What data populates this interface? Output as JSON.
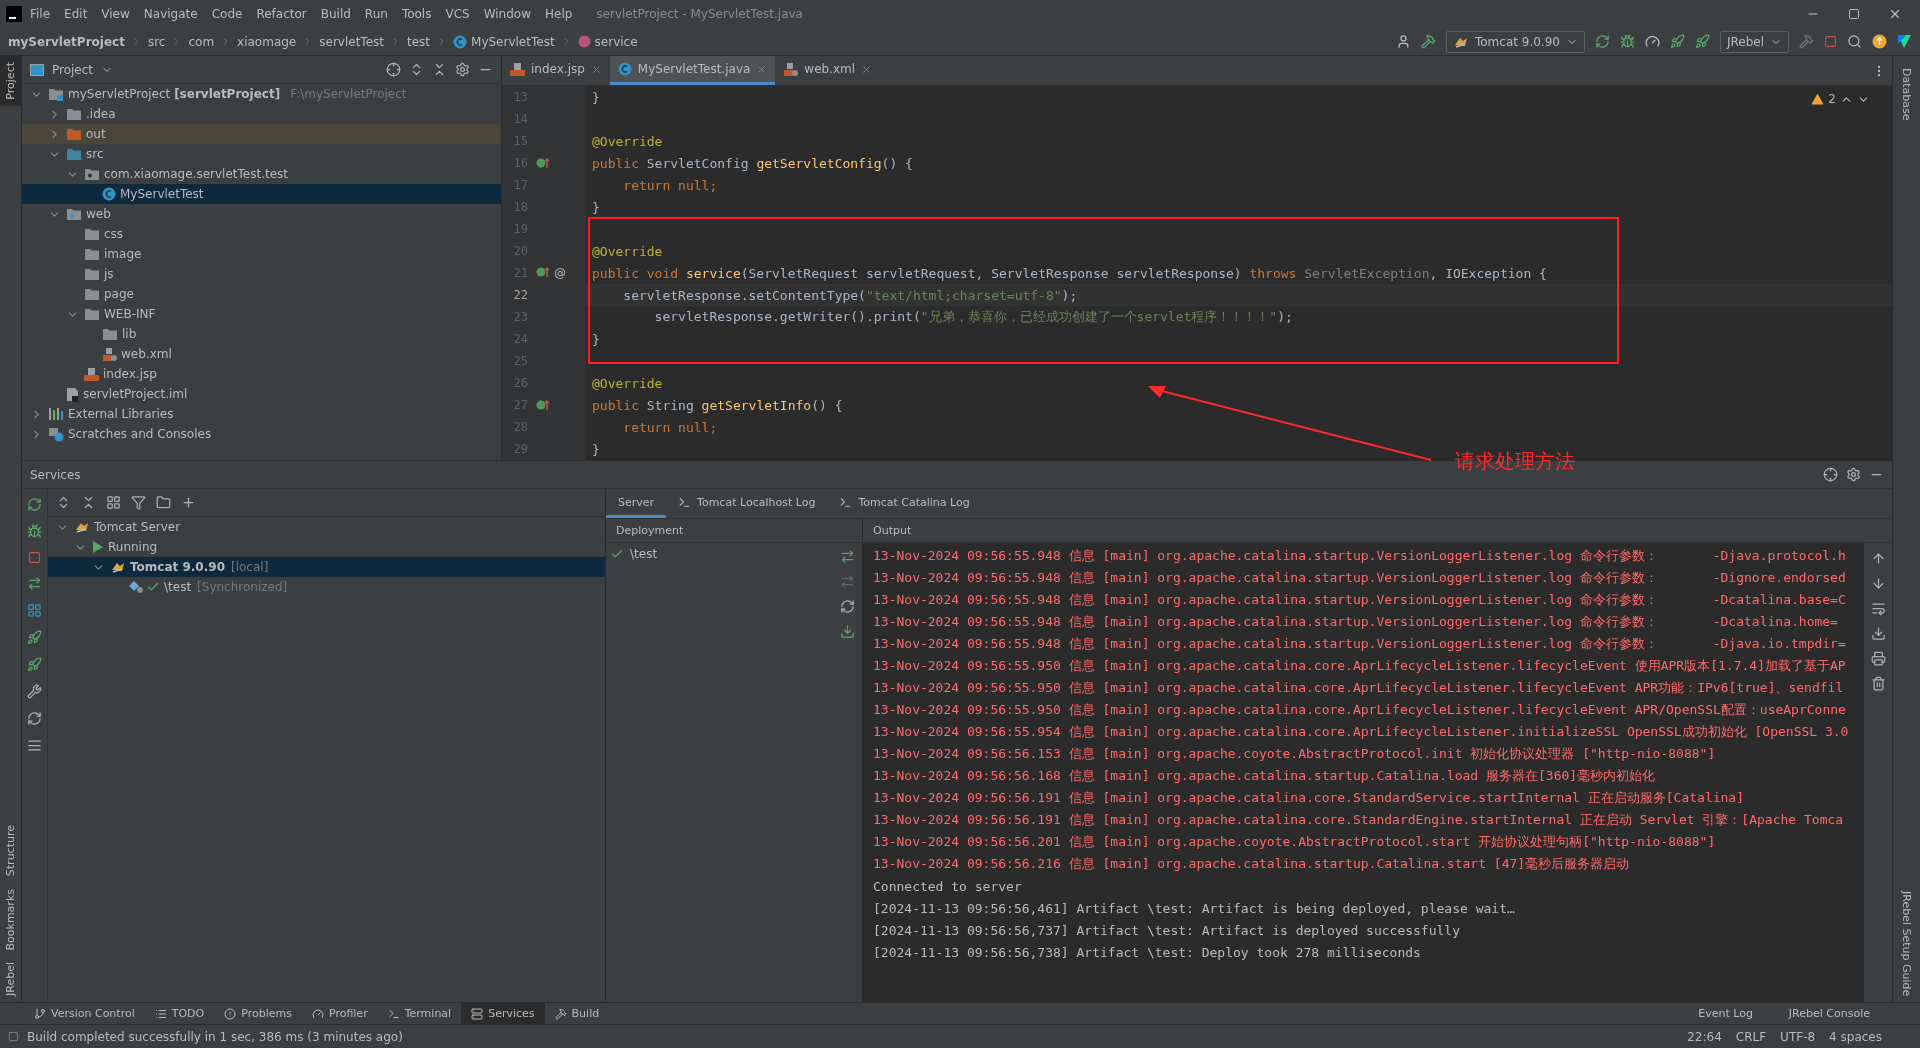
{
  "window": {
    "title": "servletProject - MyServletTest.java"
  },
  "menu": [
    "File",
    "Edit",
    "View",
    "Navigate",
    "Code",
    "Refactor",
    "Build",
    "Run",
    "Tools",
    "VCS",
    "Window",
    "Help"
  ],
  "breadcrumbs": [
    {
      "label": "myServletProject",
      "kind": "project"
    },
    {
      "label": "src",
      "kind": "plain"
    },
    {
      "label": "com",
      "kind": "plain"
    },
    {
      "label": "xiaomage",
      "kind": "plain"
    },
    {
      "label": "servletTest",
      "kind": "plain"
    },
    {
      "label": "test",
      "kind": "plain"
    },
    {
      "label": "MyServletTest",
      "kind": "class"
    },
    {
      "label": "service",
      "kind": "method"
    }
  ],
  "toolbar": {
    "run_config": "Tomcat 9.0.90",
    "jrebel": "JRebel"
  },
  "left_stripe": [
    {
      "label": "Project",
      "selected": true
    },
    {
      "label": "Structure",
      "selected": false
    },
    {
      "label": "Bookmarks",
      "selected": false
    },
    {
      "label": "JRebel",
      "selected": false
    }
  ],
  "right_stripe": [
    {
      "label": "Database"
    },
    {
      "label": "JRebel Setup Guide"
    }
  ],
  "project_panel": {
    "title": "Project",
    "tree": [
      {
        "label": "myServletProject **[servletProject]**",
        "path": "F:\\myServletProject",
        "kind": "module",
        "expanded": true,
        "selected": false,
        "children": [
          {
            "label": ".idea",
            "kind": "folder",
            "expanded": false,
            "selected": false
          },
          {
            "label": "out",
            "kind": "excluded",
            "expanded": false,
            "selected": false
          },
          {
            "label": "src",
            "kind": "source",
            "expanded": true,
            "selected": false,
            "children": [
              {
                "label": "com.xiaomage.servletTest.test",
                "kind": "package",
                "expanded": true,
                "selected": false,
                "children": [
                  {
                    "label": "MyServletTest",
                    "kind": "class",
                    "selected": true
                  }
                ]
              }
            ]
          },
          {
            "label": "web",
            "kind": "webfolder",
            "expanded": true,
            "selected": false,
            "children": [
              {
                "label": "css",
                "kind": "folder",
                "selected": false
              },
              {
                "label": "image",
                "kind": "folder",
                "selected": false
              },
              {
                "label": "js",
                "kind": "folder",
                "selected": false
              },
              {
                "label": "page",
                "kind": "folder",
                "selected": false
              },
              {
                "label": "WEB-INF",
                "kind": "folder",
                "expanded": true,
                "selected": false,
                "children": [
                  {
                    "label": "lib",
                    "kind": "folder",
                    "selected": false
                  },
                  {
                    "label": "web.xml",
                    "kind": "xml",
                    "selected": false
                  }
                ]
              },
              {
                "label": "index.jsp",
                "kind": "jsp",
                "selected": false
              }
            ]
          },
          {
            "label": "servletProject.iml",
            "kind": "iml",
            "selected": false
          }
        ]
      },
      {
        "label": "External Libraries",
        "kind": "libraries",
        "expanded": false,
        "selected": false
      },
      {
        "label": "Scratches and Consoles",
        "kind": "scratches",
        "expanded": false,
        "selected": false
      }
    ]
  },
  "editor": {
    "tabs": [
      {
        "label": "index.jsp",
        "kind": "jsp",
        "selected": false
      },
      {
        "label": "MyServletTest.java",
        "kind": "class",
        "selected": true
      },
      {
        "label": "web.xml",
        "kind": "xml",
        "selected": false
      }
    ],
    "warnings": "2",
    "lines": [
      {
        "number": "13",
        "kind": "plain",
        "current": false,
        "tokens": [
          {
            "kind": "text",
            "text": "}"
          }
        ]
      },
      {
        "number": "14",
        "kind": "plain",
        "current": false
      },
      {
        "number": "15",
        "kind": "plain",
        "current": false,
        "tokens": [
          {
            "kind": "ann",
            "text": "@Override"
          }
        ]
      },
      {
        "number": "16",
        "kind": "override",
        "current": false,
        "tokens": [
          {
            "kind": "kw",
            "text": "public "
          },
          {
            "kind": "text",
            "text": "ServletConfig "
          },
          {
            "kind": "fn",
            "text": "getServletConfig"
          },
          {
            "kind": "text",
            "text": "() {"
          }
        ]
      },
      {
        "number": "17",
        "kind": "plain",
        "current": false,
        "tokens": [
          {
            "kind": "kw",
            "text": "    return null;"
          }
        ]
      },
      {
        "number": "18",
        "kind": "plain",
        "current": false,
        "tokens": [
          {
            "kind": "text",
            "text": "}"
          }
        ]
      },
      {
        "number": "19",
        "kind": "plain",
        "current": false
      },
      {
        "number": "20",
        "kind": "plain",
        "current": false,
        "tokens": [
          {
            "kind": "ann",
            "text": "@Override"
          }
        ]
      },
      {
        "number": "21",
        "kind": "override-at",
        "marker": "@",
        "current": false,
        "tokens": [
          {
            "kind": "kw",
            "text": "public void "
          },
          {
            "kind": "fn",
            "text": "service"
          },
          {
            "kind": "text",
            "text": "(ServletRequest servletRequest, ServletResponse servletResponse) "
          },
          {
            "kind": "kw",
            "text": "throws "
          },
          {
            "kind": "dim",
            "text": "ServletException"
          },
          {
            "kind": "text",
            "text": ", IOException {"
          }
        ]
      },
      {
        "number": "22",
        "kind": "plain",
        "current": true,
        "tokens": [
          {
            "kind": "text",
            "text": "    servletResponse.setContentType("
          },
          {
            "kind": "str",
            "text": "\"text/html;charset=utf-8\""
          },
          {
            "kind": "text",
            "text": ");"
          }
        ]
      },
      {
        "number": "23",
        "kind": "plain",
        "current": false,
        "tokens": [
          {
            "kind": "text",
            "text": "        servletResponse.getWriter().print("
          },
          {
            "kind": "str",
            "text": "\"兄弟，恭喜你，已经成功创建了一个servlet程序！！！！\""
          },
          {
            "kind": "text",
            "text": ");"
          }
        ]
      },
      {
        "number": "24",
        "kind": "plain",
        "current": false,
        "tokens": [
          {
            "kind": "text",
            "text": "}"
          }
        ]
      },
      {
        "number": "25",
        "kind": "plain",
        "current": false
      },
      {
        "number": "26",
        "kind": "plain",
        "current": false,
        "tokens": [
          {
            "kind": "ann",
            "text": "@Override"
          }
        ]
      },
      {
        "number": "27",
        "kind": "override",
        "current": false,
        "tokens": [
          {
            "kind": "kw",
            "text": "public "
          },
          {
            "kind": "text",
            "text": "String "
          },
          {
            "kind": "fn",
            "text": "getServletInfo"
          },
          {
            "kind": "text",
            "text": "() {"
          }
        ]
      },
      {
        "number": "28",
        "kind": "plain",
        "current": false,
        "tokens": [
          {
            "kind": "kw",
            "text": "    return null;"
          }
        ]
      },
      {
        "number": "29",
        "kind": "plain",
        "current": false,
        "tokens": [
          {
            "kind": "text",
            "text": "}"
          }
        ]
      }
    ]
  },
  "annotation": {
    "label": "请求处理方法"
  },
  "services": {
    "title": "Services",
    "tree": [
      {
        "label": "Tomcat Server",
        "kind": "server",
        "expanded": true,
        "selected": false,
        "children": [
          {
            "label": "Running",
            "kind": "running",
            "expanded": true,
            "selected": false,
            "children": [
              {
                "label": "Tomcat 9.0.90",
                "note": "[local]",
                "kind": "tomcat",
                "expanded": true,
                "selected": true,
                "children": [
                  {
                    "label": "\\test",
                    "note": "[Synchronized]",
                    "kind": "artifact",
                    "selected": false
                  }
                ]
              }
            ]
          }
        ]
      }
    ],
    "tabs": [
      {
        "label": "Server",
        "kind": "panel",
        "selected": true
      },
      {
        "label": "Tomcat Localhost Log",
        "kind": "log",
        "selected": false
      },
      {
        "label": "Tomcat Catalina Log",
        "kind": "log",
        "selected": false
      }
    ],
    "deployment": {
      "title": "Deployment",
      "items": [
        "\\test"
      ]
    },
    "output": {
      "title": "Output",
      "lines": [
        {
          "kind": "log",
          "text": "13-Nov-2024 09:56:55.948 信息 [main] org.apache.catalina.startup.VersionLoggerListener.log 命令行参数：       -Djava.protocol.h"
        },
        {
          "kind": "log",
          "text": "13-Nov-2024 09:56:55.948 信息 [main] org.apache.catalina.startup.VersionLoggerListener.log 命令行参数：       -Dignore.endorsed"
        },
        {
          "kind": "log",
          "text": "13-Nov-2024 09:56:55.948 信息 [main] org.apache.catalina.startup.VersionLoggerListener.log 命令行参数：       -Dcatalina.base=C"
        },
        {
          "kind": "log",
          "text": "13-Nov-2024 09:56:55.948 信息 [main] org.apache.catalina.startup.VersionLoggerListener.log 命令行参数：       -Dcatalina.home="
        },
        {
          "kind": "log",
          "text": "13-Nov-2024 09:56:55.948 信息 [main] org.apache.catalina.startup.VersionLoggerListener.log 命令行参数：       -Djava.io.tmpdir="
        },
        {
          "kind": "log",
          "text": "13-Nov-2024 09:56:55.950 信息 [main] org.apache.catalina.core.AprLifecycleListener.lifecycleEvent 使用APR版本[1.7.4]加载了基于AP"
        },
        {
          "kind": "log",
          "text": "13-Nov-2024 09:56:55.950 信息 [main] org.apache.catalina.core.AprLifecycleListener.lifecycleEvent APR功能：IPv6[true]、sendfil"
        },
        {
          "kind": "log",
          "text": "13-Nov-2024 09:56:55.950 信息 [main] org.apache.catalina.core.AprLifecycleListener.lifecycleEvent APR/OpenSSL配置：useAprConne"
        },
        {
          "kind": "log",
          "text": "13-Nov-2024 09:56:55.954 信息 [main] org.apache.catalina.core.AprLifecycleListener.initializeSSL OpenSSL成功初始化 [OpenSSL 3.0"
        },
        {
          "kind": "log",
          "text": "13-Nov-2024 09:56:56.153 信息 [main] org.apache.coyote.AbstractProtocol.init 初始化协议处理器 [\"http-nio-8088\"]"
        },
        {
          "kind": "log",
          "text": "13-Nov-2024 09:56:56.168 信息 [main] org.apache.catalina.startup.Catalina.load 服务器在[360]毫秒内初始化"
        },
        {
          "kind": "log",
          "text": "13-Nov-2024 09:56:56.191 信息 [main] org.apache.catalina.core.StandardService.startInternal 正在启动服务[Catalina]"
        },
        {
          "kind": "log",
          "text": "13-Nov-2024 09:56:56.191 信息 [main] org.apache.catalina.core.StandardEngine.startInternal 正在启动 Servlet 引擎：[Apache Tomca"
        },
        {
          "kind": "log",
          "text": "13-Nov-2024 09:56:56.201 信息 [main] org.apache.coyote.AbstractProtocol.start 开始协议处理句柄[\"http-nio-8088\"]"
        },
        {
          "kind": "log",
          "text": "13-Nov-2024 09:56:56.216 信息 [main] org.apache.catalina.startup.Catalina.start [47]毫秒后服务器启动"
        },
        {
          "kind": "info",
          "text": "Connected to server"
        },
        {
          "kind": "info",
          "text": "[2024-11-13 09:56:56,461] Artifact \\test: Artifact is being deployed, please wait…"
        },
        {
          "kind": "info",
          "text": "[2024-11-13 09:56:56,737] Artifact \\test: Artifact is deployed successfully"
        },
        {
          "kind": "info",
          "text": "[2024-11-13 09:56:56,738] Artifact \\test: Deploy took 278 milliseconds"
        }
      ]
    }
  },
  "tool_tabs": [
    {
      "label": "Version Control",
      "kind": "vcs",
      "selected": false
    },
    {
      "label": "TODO",
      "kind": "todo",
      "selected": false
    },
    {
      "label": "Problems",
      "kind": "problems",
      "selected": false
    },
    {
      "label": "Profiler",
      "kind": "profiler",
      "selected": false
    },
    {
      "label": "Terminal",
      "kind": "terminal",
      "selected": false
    },
    {
      "label": "Services",
      "kind": "services",
      "selected": true
    },
    {
      "label": "Build",
      "kind": "build",
      "selected": false
    }
  ],
  "tool_tabs_right": [
    "Event Log",
    "JRebel Console"
  ],
  "status_bar": {
    "message": "Build completed successfully in 1 sec, 386 ms (3 minutes ago)",
    "items": [
      "22:64",
      "CRLF",
      "UTF-8",
      "4 spaces"
    ]
  }
}
